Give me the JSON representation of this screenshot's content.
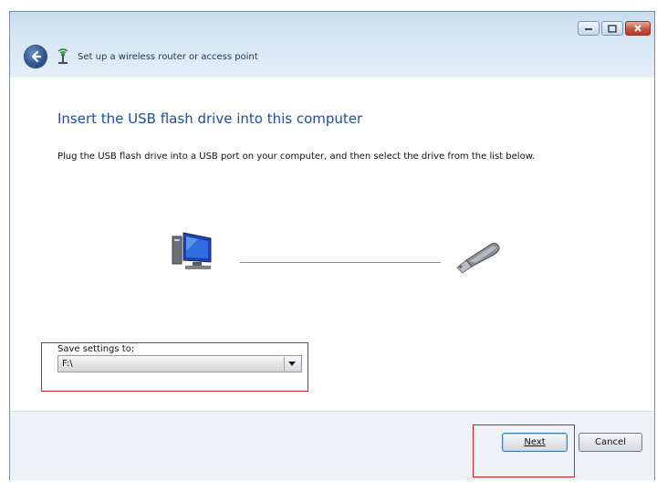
{
  "window": {
    "title": "Set up a wireless router or access point",
    "controls": [
      "minimize",
      "maximize",
      "close"
    ]
  },
  "content": {
    "heading": "Insert the USB flash drive into this computer",
    "description": "Plug the USB flash drive into a USB port on your computer, and then select the drive from the list below.",
    "save_settings_label": "Save settings to:",
    "drive_select": {
      "selected_value": "F:\\"
    }
  },
  "footer": {
    "next_label": "Next",
    "cancel_label": "Cancel"
  },
  "colors": {
    "heading": "#1f4fa0",
    "highlight": "#d42020",
    "titlebar": "#d7e6f4"
  },
  "icons": {
    "back": "back-arrow-icon",
    "wizard": "wireless-network-icon",
    "computer": "computer-icon",
    "usb": "usb-flash-drive-icon"
  }
}
